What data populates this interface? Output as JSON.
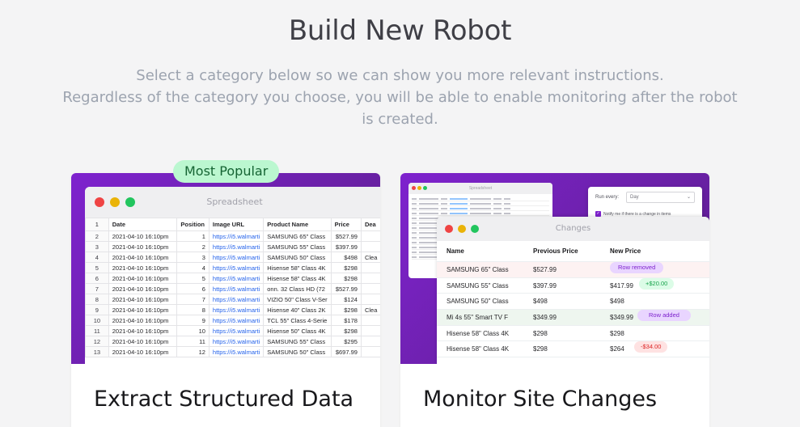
{
  "header": {
    "title": "Build New Robot",
    "subtitle_line1": "Select a category below so we can show you more relevant instructions.",
    "subtitle_line2": "Regardless of the category you choose, you will be able to enable monitoring after the robot",
    "subtitle_line3": "is created."
  },
  "cards": {
    "extract": {
      "badge": "Most Popular",
      "title": "Extract Structured Data",
      "window_title": "Spreadsheet",
      "columns": [
        "",
        "Date",
        "Position",
        "Image URL",
        "Product Name",
        "Price",
        "Dea"
      ],
      "rows": [
        [
          "2",
          "2021-04-10 16:10pm",
          "1",
          "https://i5.walmarti",
          "SAMSUNG 65\" Class",
          "$527.99",
          ""
        ],
        [
          "3",
          "2021-04-10 16:10pm",
          "2",
          "https://i5.walmarti",
          "SAMSUNG 55\" Class",
          "$397.99",
          ""
        ],
        [
          "4",
          "2021-04-10 16:10pm",
          "3",
          "https://i5.walmarti",
          "SAMSUNG 50\" Class",
          "$498",
          "Clea"
        ],
        [
          "5",
          "2021-04-10 16:10pm",
          "4",
          "https://i5.walmarti",
          "Hisense 58\" Class 4K",
          "$298",
          ""
        ],
        [
          "6",
          "2021-04-10 16:10pm",
          "5",
          "https://i5.walmarti",
          "Hisense 58\" Class 4K",
          "$298",
          ""
        ],
        [
          "7",
          "2021-04-10 16:10pm",
          "6",
          "https://i5.walmarti",
          "onn. 32 Class HD (72",
          "$527.99",
          ""
        ],
        [
          "8",
          "2021-04-10 16:10pm",
          "7",
          "https://i5.walmarti",
          "VIZIO 50\" Class V-Ser",
          "$124",
          ""
        ],
        [
          "9",
          "2021-04-10 16:10pm",
          "8",
          "https://i5.walmarti",
          "Hisense 40\" Class 2K",
          "$298",
          "Clea"
        ],
        [
          "10",
          "2021-04-10 16:10pm",
          "9",
          "https://i5.walmarti",
          "TCL 55\" Class 4-Serie",
          "$178",
          ""
        ],
        [
          "11",
          "2021-04-10 16:10pm",
          "10",
          "https://i5.walmarti",
          "Hisense 50\" Class 4K",
          "$298",
          ""
        ],
        [
          "12",
          "2021-04-10 16:10pm",
          "11",
          "https://i5.walmarti",
          "SAMSUNG 55\" Class",
          "$295",
          ""
        ],
        [
          "13",
          "2021-04-10 16:10pm",
          "12",
          "https://i5.walmarti",
          "SAMSUNG 50\" Class",
          "$697.99",
          ""
        ]
      ],
      "header_row_number": "1"
    },
    "monitor": {
      "title": "Monitor Site Changes",
      "mini_title": "Spreadsheet",
      "run_every_label": "Run every:",
      "run_every_value": "Day",
      "notify_label": "Notify me if there is a change in items",
      "changes_title": "Changes",
      "columns": [
        "Name",
        "Previous Price",
        "New Price"
      ],
      "rows": [
        {
          "name": "SAMSUNG 65\" Class",
          "prev": "$527.99",
          "new": "",
          "pill": "Row removed",
          "pill_type": "removed",
          "state": "removed"
        },
        {
          "name": "SAMSUNG 55\" Class",
          "prev": "$397.99",
          "new": "$417.99",
          "pill": "+$20.00",
          "pill_type": "up",
          "state": ""
        },
        {
          "name": "SAMSUNG 50\" Class",
          "prev": "$498",
          "new": "$498",
          "pill": "",
          "pill_type": "",
          "state": ""
        },
        {
          "name": "Mi 4s 55\" Smart TV F",
          "prev": "$349.99",
          "new": "$349.99",
          "pill": "Row added",
          "pill_type": "added",
          "state": "added"
        },
        {
          "name": "Hisense 58\" Class 4K",
          "prev": "$298",
          "new": "$298",
          "pill": "",
          "pill_type": "",
          "state": ""
        },
        {
          "name": "Hisense 58\" Class 4K",
          "prev": "$298",
          "new": "$264",
          "pill": "-$34.00",
          "pill_type": "down",
          "state": ""
        }
      ]
    }
  },
  "colors": {
    "accent_purple": "#7e22ce",
    "badge_green": "#bbf7d0",
    "link_blue": "#2563eb"
  }
}
